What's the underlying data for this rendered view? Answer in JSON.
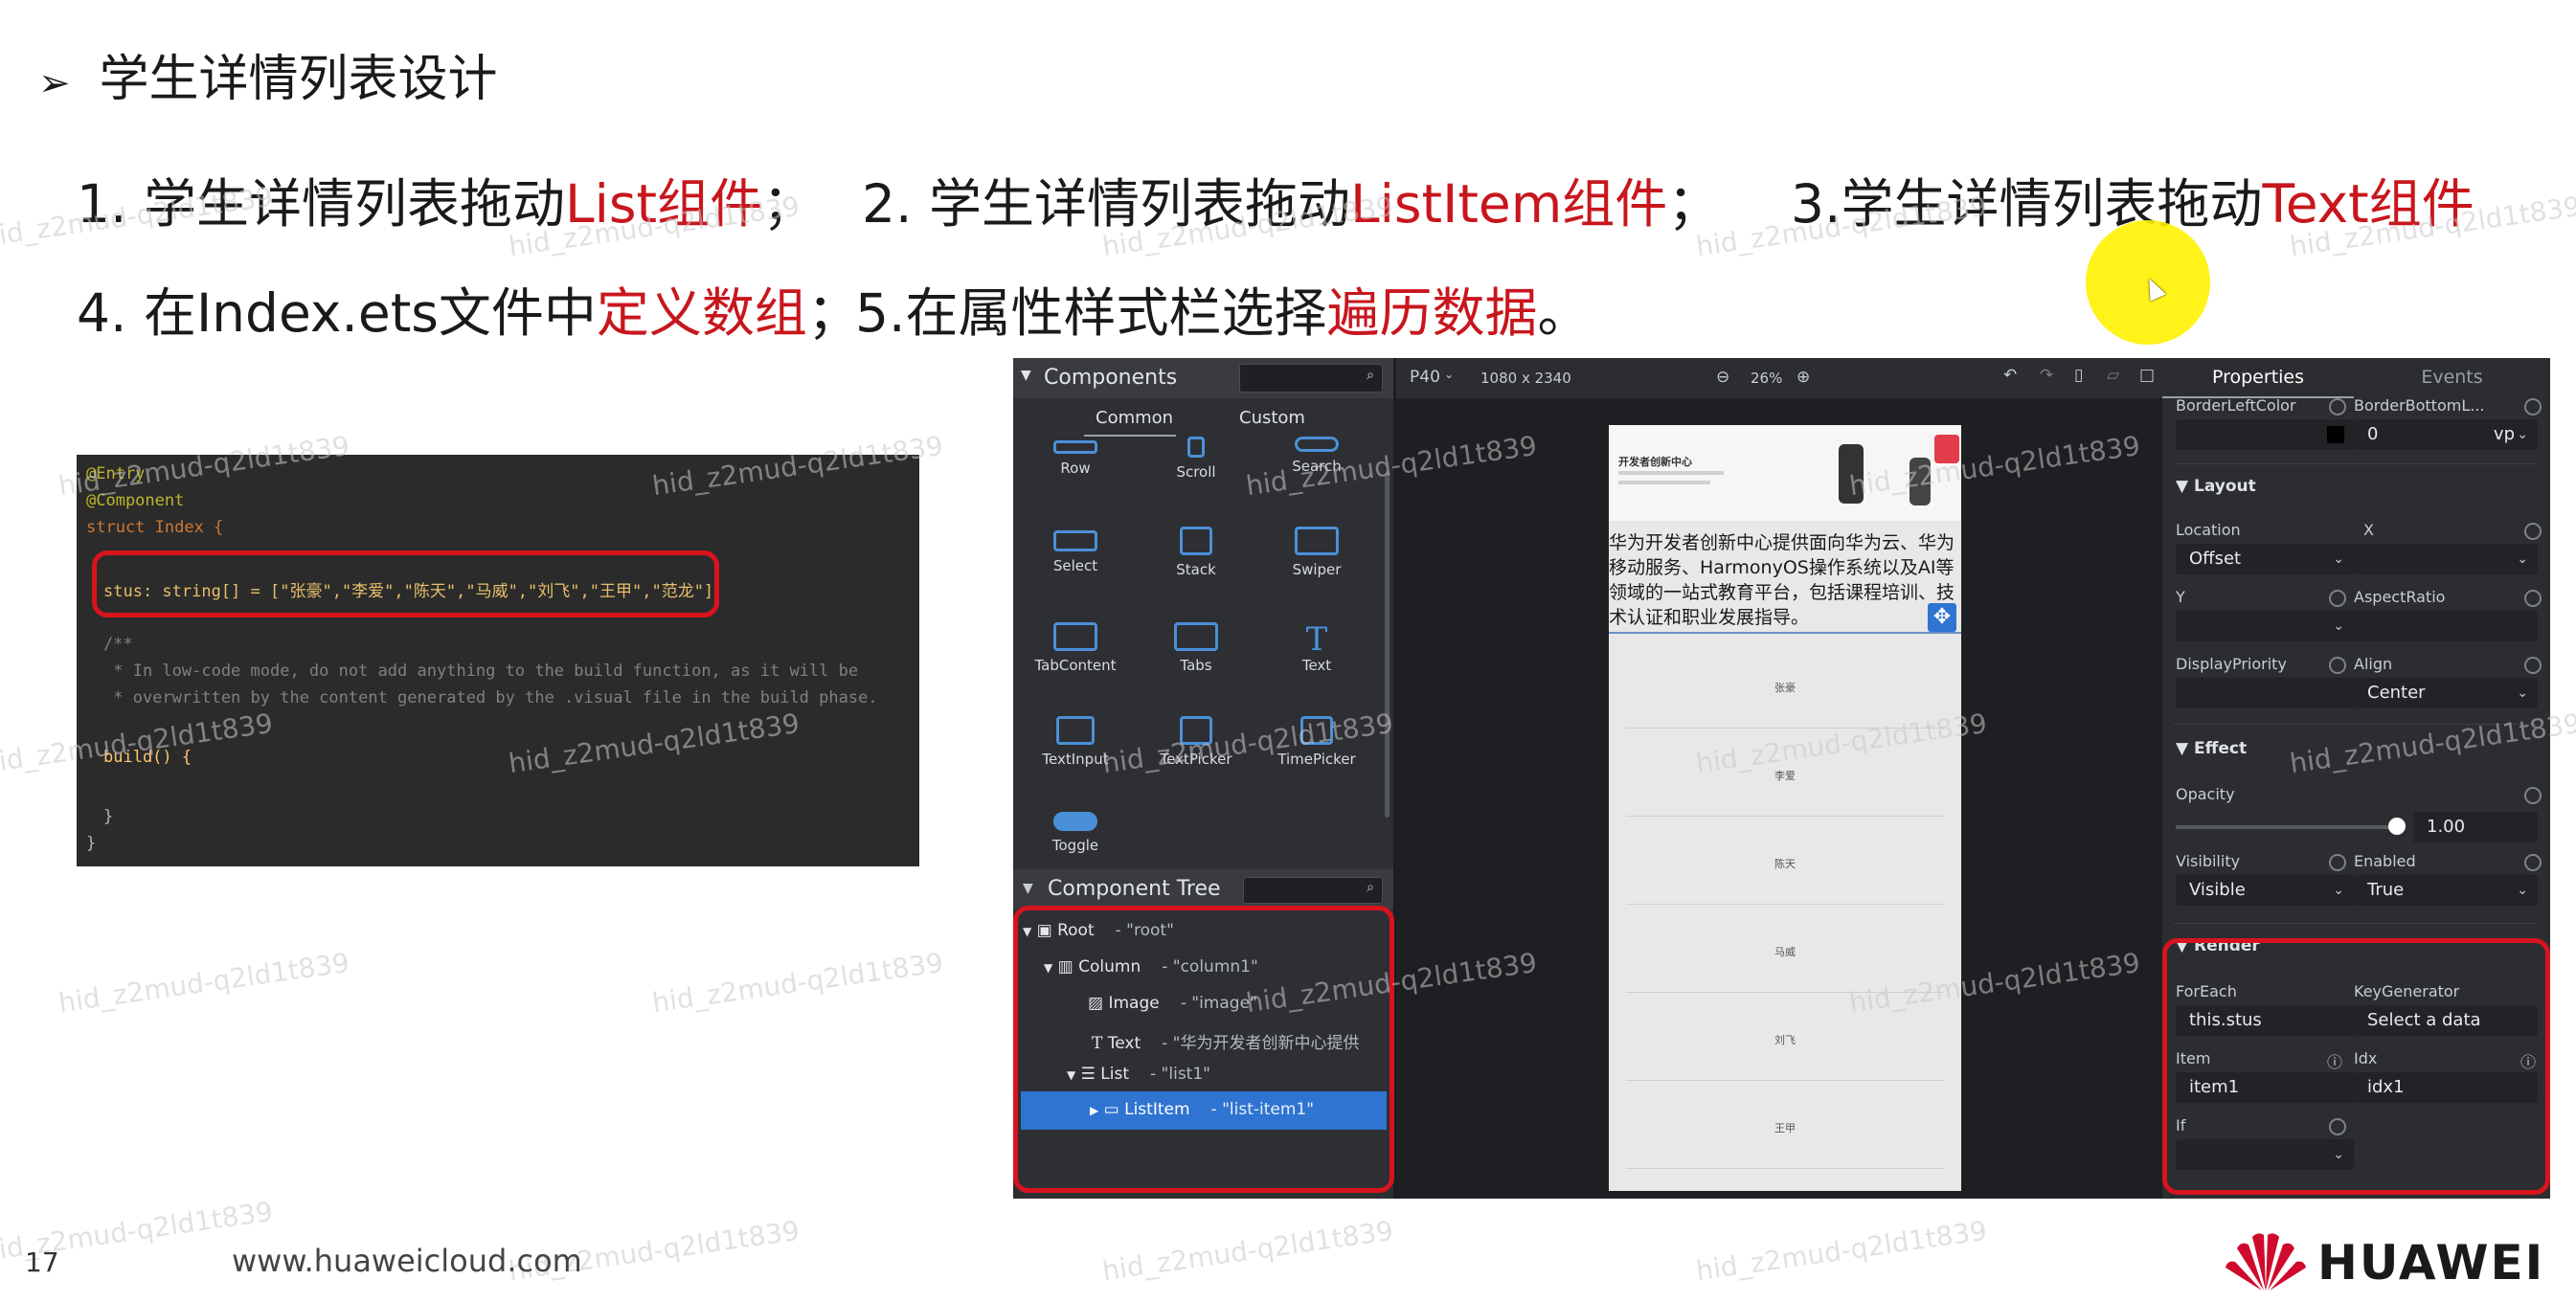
{
  "slide": {
    "title": "学生详情列表设计",
    "steps": [
      {
        "prefix": "1. 学生详情列表拖动",
        "highlight": "List组件",
        "suffix": "；"
      },
      {
        "prefix": "2. 学生详情列表拖动",
        "highlight": "ListItem组件",
        "suffix": "；"
      },
      {
        "prefix": "3.学生详情列表拖动",
        "highlight": "Text组件",
        "suffix": ""
      },
      {
        "prefix": "4. 在Index.ets文件中",
        "highlight": "定义数组",
        "suffix": "；"
      },
      {
        "prefix": "5.在属性样式栏选择",
        "highlight": "遍历数据",
        "suffix": "。"
      }
    ],
    "page_number": "17",
    "footer_url": "www.huaweicloud.com",
    "brand": "HUAWEI",
    "watermark": "hid_z2mud-q2ld1t839"
  },
  "code": {
    "lines": [
      "@Entry",
      "@Component",
      "struct Index {",
      "stus: string[] = [\"张豪\",\"李爱\",\"陈天\",\"马威\",\"刘飞\",\"王甲\",\"范龙\"]",
      "/**",
      " * In low-code mode, do not add anything to the build function, as it will be",
      " * overwritten by the content generated by the .visual file in the build phase.",
      "build() {",
      "}",
      "}"
    ]
  },
  "ide": {
    "components_title": "Components",
    "tabs": [
      "Common",
      "Custom"
    ],
    "components": [
      "Row",
      "Scroll",
      "Search",
      "Select",
      "Stack",
      "Swiper",
      "TabContent",
      "Tabs",
      "Text",
      "TextInput",
      "TextPicker",
      "TimePicker",
      "Toggle"
    ],
    "tree_title": "Component Tree",
    "tree": [
      {
        "name": "Root",
        "id": "- \"root\""
      },
      {
        "name": "Column",
        "id": "- \"column1\""
      },
      {
        "name": "Image",
        "id": "- \"image\""
      },
      {
        "name": "Text",
        "id": "- \"华为开发者创新中心提供"
      },
      {
        "name": "List",
        "id": "- \"list1\""
      },
      {
        "name": "ListItem",
        "id": "- \"list-item1\""
      }
    ],
    "device": "P40",
    "resolution": "1080 x 2340",
    "zoom": "26%",
    "phone": {
      "banner_title": "开发者创新中心",
      "text": "华为开发者创新中心提供面向华为云、华为移动服务、HarmonyOS操作系统以及AI等领域的一站式教育平台，包括课程培训、技术认证和职业发展指导。",
      "items": [
        "张豪",
        "李爱",
        "陈天",
        "马威",
        "刘飞",
        "王甲"
      ]
    },
    "props": {
      "tabs": [
        "Properties",
        "Events"
      ],
      "border_left_color": "BorderLeftColor",
      "border_bottom": "BorderBottomL...",
      "border_value": "0",
      "border_unit": "vp",
      "layout": "Layout",
      "location": "Location",
      "location_value": "Offset",
      "x": "X",
      "y": "Y",
      "aspect_ratio": "AspectRatio",
      "display_priority": "DisplayPriority",
      "align": "Align",
      "align_value": "Center",
      "effect": "Effect",
      "opacity": "Opacity",
      "opacity_value": "1.00",
      "visibility": "Visibility",
      "visibility_value": "Visible",
      "enabled": "Enabled",
      "enabled_value": "True",
      "render": "Render",
      "foreach": "ForEach",
      "foreach_value": "this.stus",
      "key_generator": "KeyGenerator",
      "key_generator_value": "Select a data",
      "item": "Item",
      "item_value": "item1",
      "idx": "Idx",
      "idx_value": "idx1",
      "if": "If"
    }
  },
  "colors": {
    "accent_red": "#c8161d",
    "box_red": "#d7141e",
    "selection_blue": "#2f74d0",
    "pointer_highlight": "#fff200"
  }
}
